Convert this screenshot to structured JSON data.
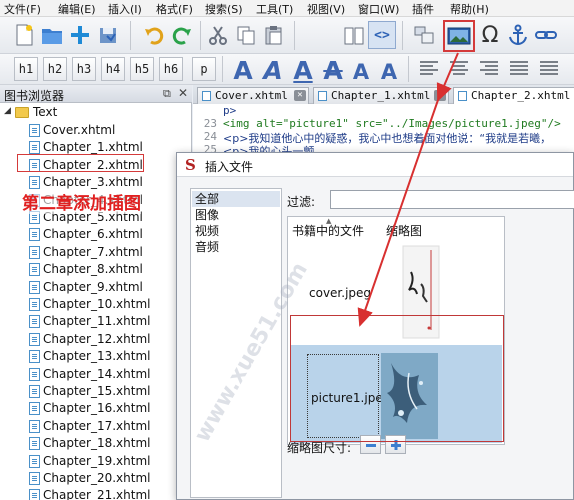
{
  "menu": [
    "文件(F)",
    "编辑(E)",
    "插入(I)",
    "格式(F)",
    "搜索(S)",
    "工具(T)",
    "视图(V)",
    "窗口(W)",
    "插件",
    "帮助(H)"
  ],
  "toolbar": {
    "icons": [
      "new-file-icon",
      "open-folder-icon",
      "add-icon",
      "save-icon",
      "undo-icon",
      "redo-icon",
      "cut-icon",
      "copy-icon",
      "paste-icon",
      "book-view-icon",
      "code-view-icon",
      "split-view-icon",
      "insert-image-icon",
      "omega-icon",
      "anchor-icon",
      "link-icon"
    ],
    "omega": "Ω",
    "code_view": "<>",
    "headings": [
      "h1",
      "h2",
      "h3",
      "h4",
      "h5",
      "h6",
      "p"
    ],
    "text_format_labels": [
      "A",
      "A",
      "A",
      "A",
      "A",
      "A"
    ]
  },
  "browser": {
    "title": "图书浏览器",
    "folder": "Text",
    "files": [
      "Cover.xhtml",
      "Chapter_1.xhtml",
      "Chapter_2.xhtml",
      "Chapter_3.xhtml",
      "Chapter_4.xhtml",
      "Chapter_5.xhtml",
      "Chapter_6.xhtml",
      "Chapter_7.xhtml",
      "Chapter_8.xhtml",
      "Chapter_9.xhtml",
      "Chapter_10.xhtml",
      "Chapter_11.xhtml",
      "Chapter_12.xhtml",
      "Chapter_13.xhtml",
      "Chapter_14.xhtml",
      "Chapter_15.xhtml",
      "Chapter_16.xhtml",
      "Chapter_17.xhtml",
      "Chapter_18.xhtml",
      "Chapter_19.xhtml",
      "Chapter_20.xhtml",
      "Chapter_21.xhtml"
    ],
    "annotation": "第二章添加插图"
  },
  "tabs": [
    "Cover.xhtml",
    "Chapter_1.xhtml",
    "Chapter_2.xhtml"
  ],
  "code": {
    "lines": [
      {
        "num": "",
        "text": "p>"
      },
      {
        "num": "23",
        "text": "<img alt=\"picture1\" src=\"../Images/picture1.jpeg\"/>"
      },
      {
        "num": "24",
        "text": "<p>我知道他心中的疑惑，我心中也想着面对他说：“我就是若曦，"
      },
      {
        "num": "25",
        "text": "<p>我的心头一颤，……"
      }
    ]
  },
  "dialog": {
    "title": "插入文件",
    "categories": [
      "全部",
      "图像",
      "视频",
      "音频"
    ],
    "selected_category": "全部",
    "filter_label": "过滤:",
    "filter_value": "",
    "columns": [
      "书籍中的文件",
      "缩略图"
    ],
    "files": [
      {
        "name": "cover.jpeg"
      },
      {
        "name": "picture1.jpeg"
      }
    ],
    "selected_file": "picture1.jpeg",
    "thumb_size_label": "缩略图尺寸:"
  },
  "watermark": "www.xue51.com"
}
